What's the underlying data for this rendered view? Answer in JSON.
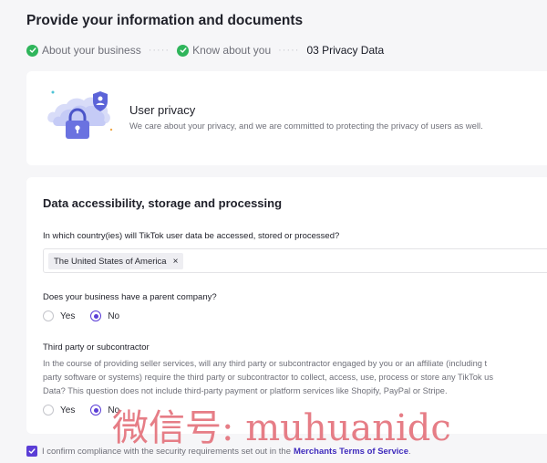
{
  "page": {
    "title": "Provide your information and documents"
  },
  "steps": [
    {
      "label": "About your business",
      "status": "complete"
    },
    {
      "label": "Know about you",
      "status": "complete"
    },
    {
      "label": "03 Privacy Data",
      "status": "current"
    }
  ],
  "privacy_card": {
    "title": "User privacy",
    "description": "We care about your privacy, and we are committed to protecting the privacy of users as well.",
    "icon": "cloud-lock-illustration"
  },
  "data_section": {
    "title": "Data accessibility, storage and processing",
    "country_question": "In which country(ies) will TikTok user data be accessed, stored or processed?",
    "selected_countries": [
      "The United States of America"
    ],
    "remove_icon": "×",
    "parent_question": "Does your business have a parent company?",
    "parent_options": {
      "yes": "Yes",
      "no": "No",
      "selected": "No"
    },
    "third_party_title": "Third party or subcontractor",
    "third_party_lines": [
      "In the course of providing seller services, will any third party or subcontractor engaged by you or an affiliate (including t",
      "party software or systems) require the third party or subcontractor to collect, access, use, process or store any TikTok us",
      "Data? This question does not include third-party payment or platform services like Shopify, PayPal or Stripe."
    ],
    "third_party_options": {
      "yes": "Yes",
      "no": "No",
      "selected": "No"
    }
  },
  "confirm": {
    "checked": true,
    "text": "I confirm compliance with the security requirements set out in the",
    "link": "Merchants Terms of Service",
    "suffix": "."
  },
  "watermark": "微信号: muhuanidc",
  "colors": {
    "accent": "#5b3ed6",
    "success": "#2fb55b",
    "link": "#3f2bbd"
  }
}
